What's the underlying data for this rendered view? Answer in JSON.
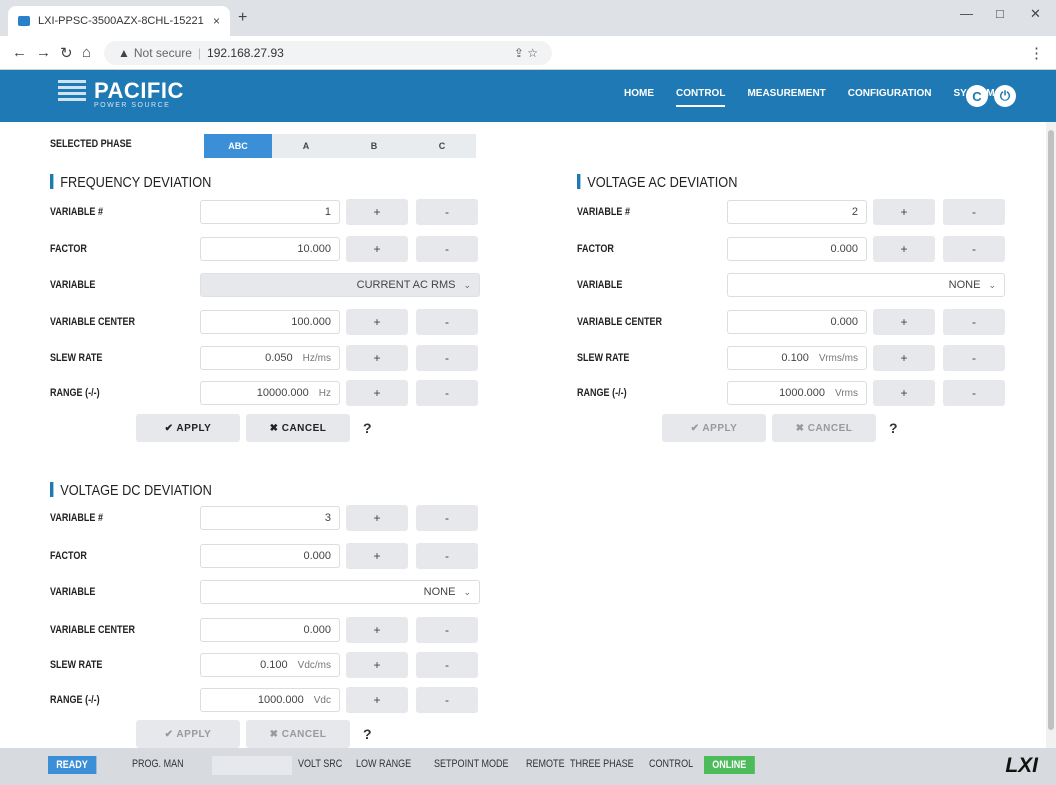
{
  "browser": {
    "tab_title": "LXI-PPSC-3500AZX-8CHL-15221",
    "tab_close": "×",
    "new_tab": "+",
    "not_secure": "Not secure",
    "url": "192.168.27.93",
    "min": "—",
    "max": "□",
    "close": "✕"
  },
  "header": {
    "brand": "PACIFIC",
    "brand_sub": "POWER SOURCE",
    "nav": [
      "HOME",
      "CONTROL",
      "MEASUREMENT",
      "CONFIGURATION",
      "SYSTEM"
    ],
    "active_nav": "CONTROL"
  },
  "phase": {
    "label": "SELECTED PHASE",
    "options": [
      "ABC",
      "A",
      "B",
      "C"
    ],
    "selected": "ABC"
  },
  "freq": {
    "title": "FREQUENCY DEVIATION",
    "var_label": "VARIABLE #",
    "var_value": "1",
    "factor_label": "FACTOR",
    "factor_value": "10.000",
    "variable_label": "VARIABLE",
    "variable_value": "CURRENT AC RMS",
    "center_label": "VARIABLE CENTER",
    "center_value": "100.000",
    "slew_label": "SLEW RATE",
    "slew_value": "0.050",
    "slew_unit": "Hz/ms",
    "range_label": "RANGE (-/-)",
    "range_value": "10000.000",
    "range_unit": "Hz"
  },
  "vac": {
    "title": "VOLTAGE AC DEVIATION",
    "var_label": "VARIABLE #",
    "var_value": "2",
    "factor_label": "FACTOR",
    "factor_value": "0.000",
    "variable_label": "VARIABLE",
    "variable_value": "NONE",
    "center_label": "VARIABLE CENTER",
    "center_value": "0.000",
    "slew_label": "SLEW RATE",
    "slew_value": "0.100",
    "slew_unit": "Vrms/ms",
    "range_label": "RANGE (-/-)",
    "range_value": "1000.000",
    "range_unit": "Vrms"
  },
  "vdc": {
    "title": "VOLTAGE DC DEVIATION",
    "var_label": "VARIABLE #",
    "var_value": "3",
    "factor_label": "FACTOR",
    "factor_value": "0.000",
    "variable_label": "VARIABLE",
    "variable_value": "NONE",
    "center_label": "VARIABLE CENTER",
    "center_value": "0.000",
    "slew_label": "SLEW RATE",
    "slew_value": "0.100",
    "slew_unit": "Vdc/ms",
    "range_label": "RANGE (-/-)",
    "range_value": "1000.000",
    "range_unit": "Vdc"
  },
  "buttons": {
    "plus": "+",
    "minus": "-",
    "apply": "✔ APPLY",
    "cancel": "✖ CANCEL",
    "help": "?"
  },
  "status": {
    "ready": "READY",
    "prog": "PROG. MAN",
    "volt_src": "VOLT SRC",
    "low_range": "LOW RANGE",
    "setpoint": "SETPOINT MODE",
    "remote": "REMOTE",
    "three_phase": "THREE PHASE",
    "control": "CONTROL",
    "online": "ONLINE",
    "lxi": "LXI"
  },
  "colors": {
    "brand_blue": "#1f79b5",
    "selected_blue": "#3b8fd6",
    "online_green": "#4cbb5a"
  }
}
